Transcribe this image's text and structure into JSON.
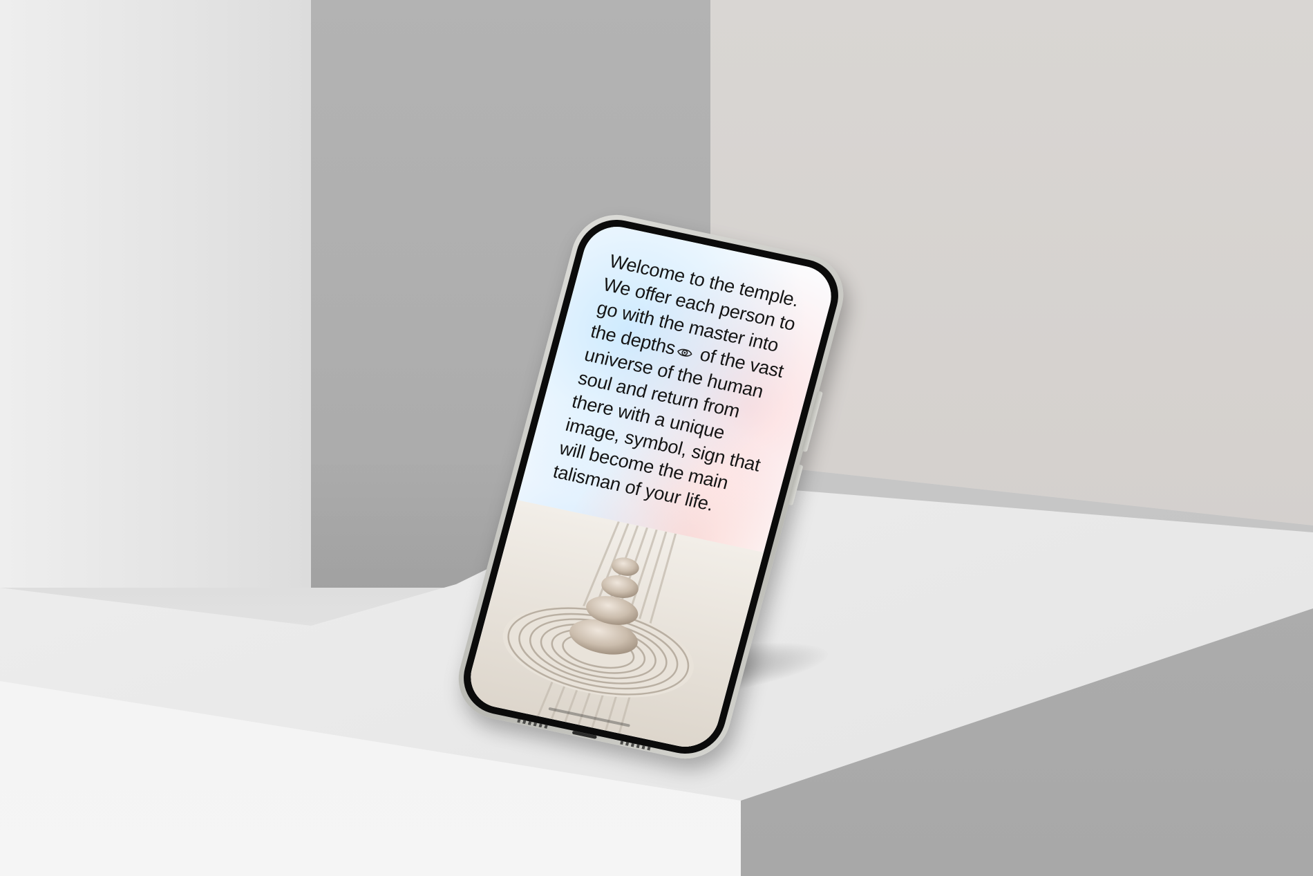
{
  "screen": {
    "welcome_text": "Welcome to the temple. We offer each person to go with the master into the depths",
    "welcome_text_after_icon": " of the vast universe of the human soul and return from there with a unique image, symbol, sign that will become the main talisman of your life.",
    "inline_icon": "eye-icon",
    "image_subject": "zen-stones-on-raked-sand"
  },
  "colors": {
    "text": "#151515",
    "wall": "#d9d6d3",
    "block_face": "#b0b0b0",
    "phone_frame": "#c9c9c4"
  }
}
